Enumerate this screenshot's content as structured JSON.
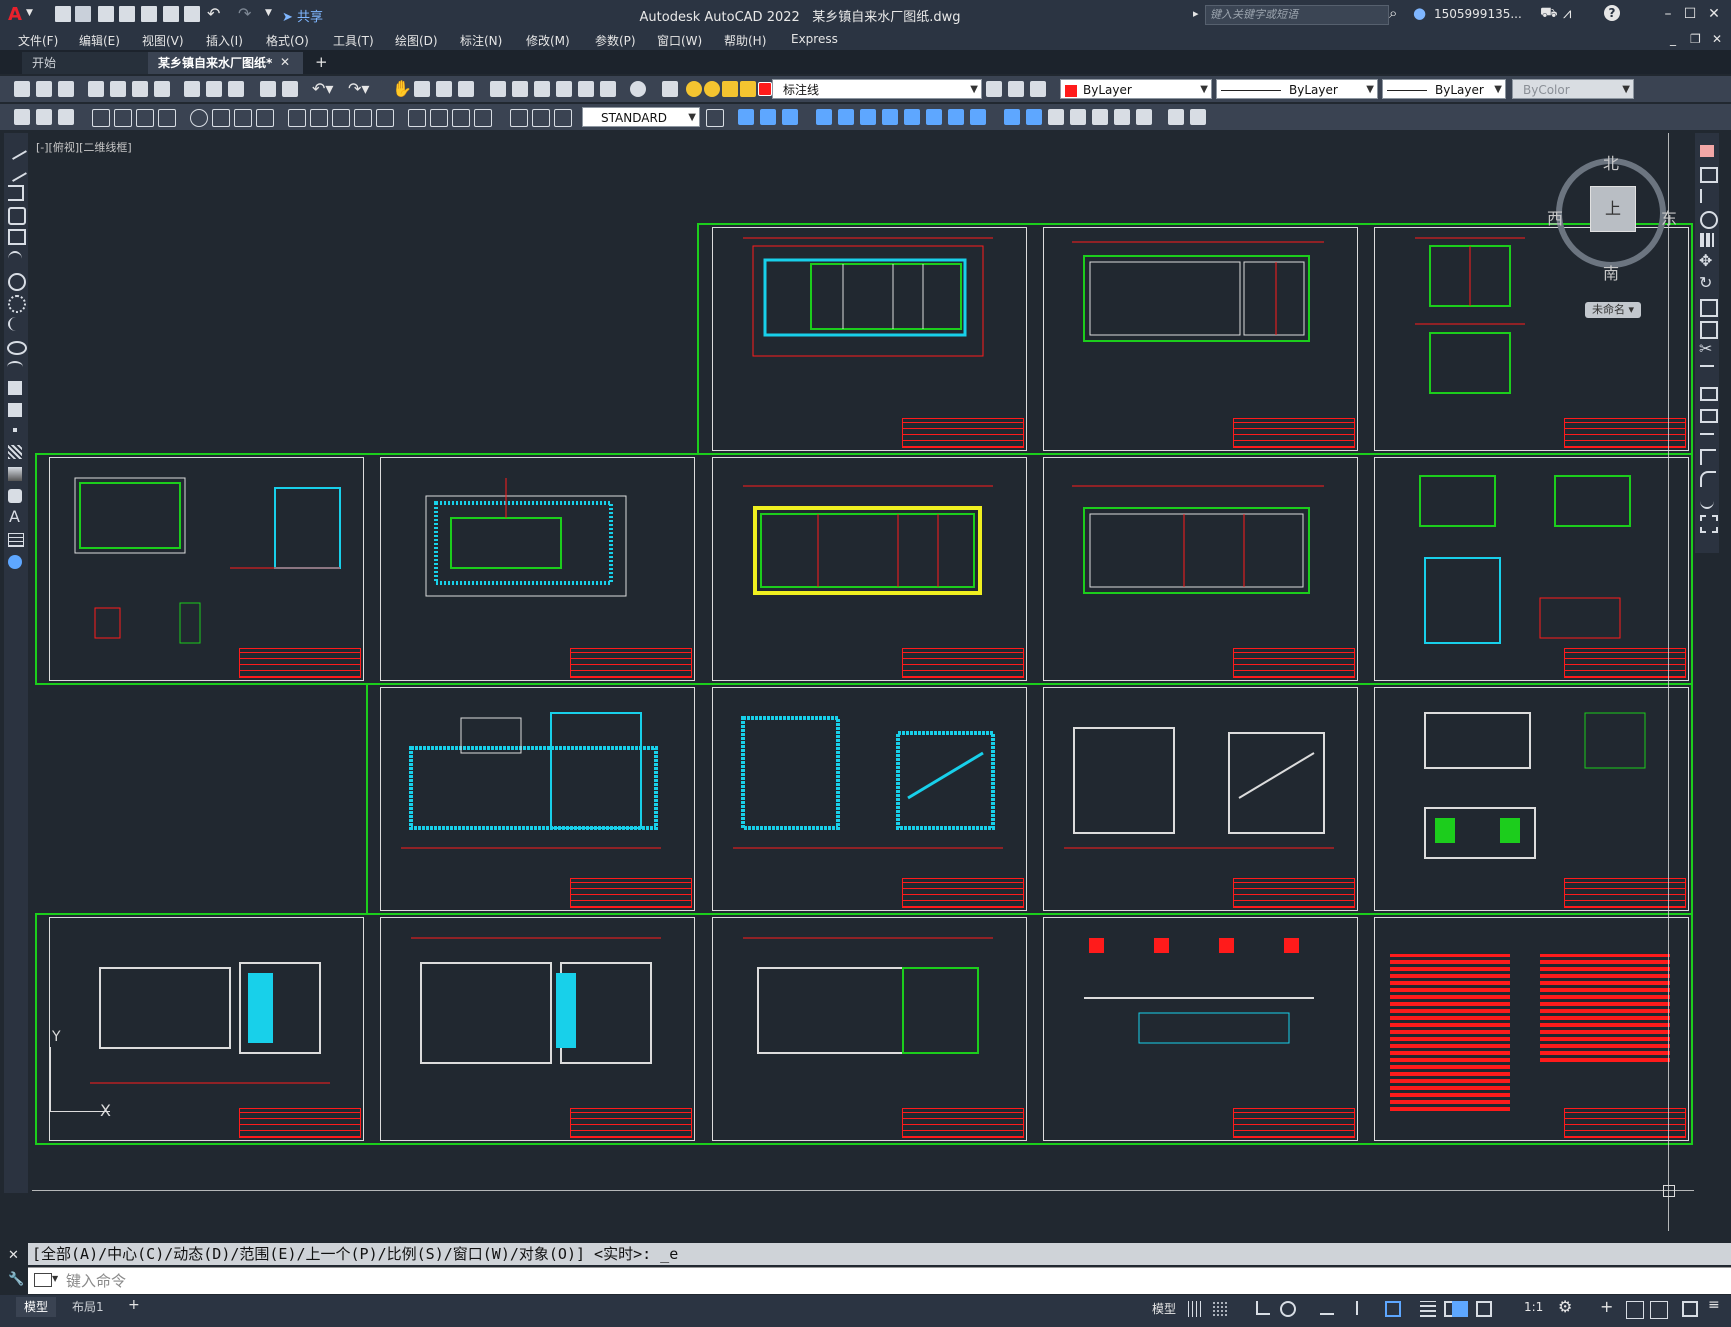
{
  "app": {
    "name": "Autodesk AutoCAD 2022",
    "file": "某乡镇自来水厂图纸.dwg",
    "logo": "A",
    "share_label": "共享",
    "search_placeholder": "键入关键字或短语",
    "user": "1505999135...",
    "help": "?"
  },
  "menu": [
    "文件(F)",
    "编辑(E)",
    "视图(V)",
    "插入(I)",
    "格式(O)",
    "工具(T)",
    "绘图(D)",
    "标注(N)",
    "修改(M)",
    "参数(P)",
    "窗口(W)",
    "帮助(H)",
    "Express"
  ],
  "tabs": [
    {
      "label": "开始",
      "active": false
    },
    {
      "label": "某乡镇自来水厂图纸*",
      "active": true
    }
  ],
  "toolbar": {
    "layer_name": "标注线",
    "color": "ByLayer",
    "linetype": "ByLayer",
    "lineweight": "ByLayer",
    "plotstyle": "ByColor",
    "text_style": "STANDARD"
  },
  "viewport": {
    "label": "[-][俯视][二维线框]"
  },
  "viewcube": {
    "north": "北",
    "south": "南",
    "east": "东",
    "west": "西",
    "face": "上",
    "ucs": "未命名"
  },
  "ucs_axes": {
    "x": "X",
    "y": "Y"
  },
  "command": {
    "history": "[全部(A)/中心(C)/动态(D)/范围(E)/上一个(P)/比例(S)/窗口(W)/对象(O)] <实时>: _e",
    "placeholder": "键入命令"
  },
  "status": {
    "layout_tabs": [
      "模型",
      "布局1"
    ],
    "model_label": "模型",
    "scale": "1:1"
  },
  "colors": {
    "frame": "#1ccd1c",
    "drawing_red": "#ff1b1b",
    "drawing_cyan": "#18d0ea",
    "drawing_white": "#dcdcdc",
    "background": "#212830"
  }
}
